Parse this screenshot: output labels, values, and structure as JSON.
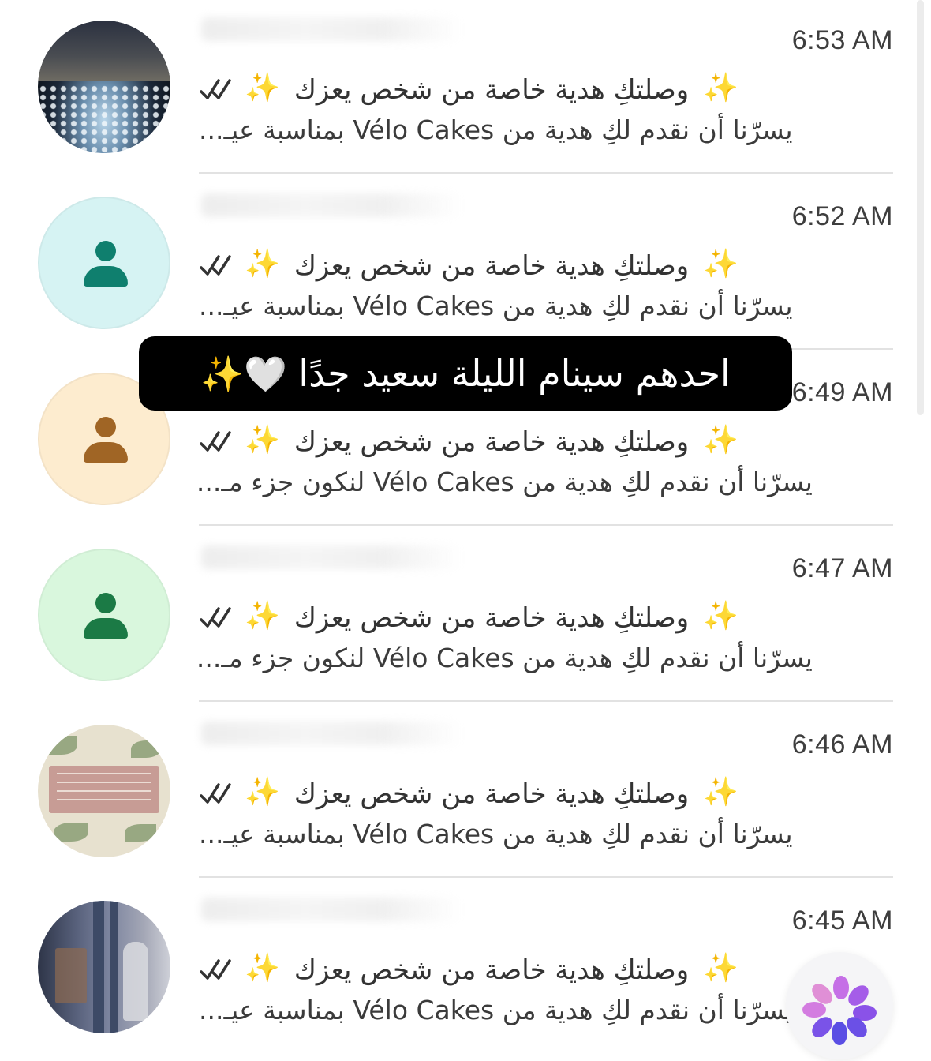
{
  "conversations": [
    {
      "time": "6:53 AM",
      "avatar": "photo-night-lights",
      "line1": "وصلتكِ هدية خاصة من شخص يعزك",
      "line2": "يسرّنا أن نقدم لكِ هدية من Vélo Cakes بمناسبة عيـ..."
    },
    {
      "time": "6:52 AM",
      "avatar": "default-person",
      "avatar_bg": "#d6f3f3",
      "avatar_fg": "#0f7f6e",
      "line1": "وصلتكِ هدية خاصة من شخص يعزك",
      "line2": "يسرّنا أن نقدم لكِ هدية من Vélo Cakes بمناسبة عيـ..."
    },
    {
      "time": "6:49 AM",
      "avatar": "default-person",
      "avatar_bg": "#fdeccf",
      "avatar_fg": "#a06525",
      "line1": "وصلتكِ هدية خاصة من شخص يعزك",
      "line2": "يسرّنا أن نقدم لكِ هدية من Vélo Cakes لنكون جزء مـ..."
    },
    {
      "time": "6:47 AM",
      "avatar": "default-person",
      "avatar_bg": "#d9f7dd",
      "avatar_fg": "#1b7a45",
      "line1": "وصلتكِ هدية خاصة من شخص يعزك",
      "line2": "يسرّنا أن نقدم لكِ هدية من Vélo Cakes لنكون جزء مـ..."
    },
    {
      "time": "6:46 AM",
      "avatar": "photo-floral-card",
      "line1": "وصلتكِ هدية خاصة من شخص يعزك",
      "line2": "يسرّنا أن نقدم لكِ هدية من Vélo Cakes بمناسبة عيـ..."
    },
    {
      "time": "6:45 AM",
      "avatar": "photo-church-statue",
      "line1": "وصلتكِ هدية خاصة من شخص يعزك",
      "line2": "يسرّنا أن نقدم لكِ هدية من Vélo Cakes بمناسبة عيـ..."
    }
  ],
  "sparkle": "✨",
  "caption": {
    "text": "احدهم سينام الليلة سعيد جدًا",
    "emoji": "🤍✨"
  },
  "icons": {
    "read_receipt": "double-check-icon",
    "fab": "flower-spinner-icon"
  },
  "colors": {
    "sparkle": "#f2c230",
    "caption_bg": "#000000",
    "caption_fg": "#ffffff",
    "divider": "#e2e2e2"
  }
}
